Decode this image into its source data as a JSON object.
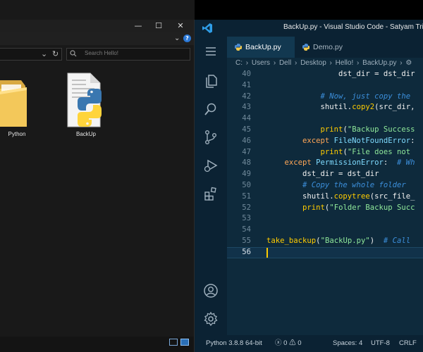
{
  "explorer": {
    "window_controls": {
      "minimize": "—",
      "maximize": "☐",
      "close": "✕"
    },
    "search_placeholder": "Search Hello!",
    "files": [
      {
        "name": "Python",
        "type": "folder"
      },
      {
        "name": "BackUp",
        "type": "python-file"
      }
    ]
  },
  "vscode": {
    "title": "BackUp.py - Visual Studio Code - Satyam Trip",
    "tabs": [
      {
        "label": "BackUp.py",
        "active": true
      },
      {
        "label": "Demo.py",
        "active": false
      }
    ],
    "breadcrumb": [
      "C:",
      "Users",
      "Dell",
      "Desktop",
      "Hello!",
      "BackUp.py",
      "⚙"
    ],
    "lines": [
      {
        "n": "40",
        "tokens": [
          [
            "var",
            "                dst_dir = dst_dir"
          ]
        ]
      },
      {
        "n": "41",
        "tokens": []
      },
      {
        "n": "42",
        "tokens": [
          [
            "cm",
            "            # Now, just copy the"
          ]
        ]
      },
      {
        "n": "43",
        "tokens": [
          [
            "var",
            "            shutil."
          ],
          [
            "fn",
            "copy2"
          ],
          [
            "var",
            "(src_dir,"
          ]
        ]
      },
      {
        "n": "44",
        "tokens": []
      },
      {
        "n": "45",
        "tokens": [
          [
            "fn",
            "            print"
          ],
          [
            "var",
            "("
          ],
          [
            "str",
            "\"Backup Success"
          ]
        ]
      },
      {
        "n": "46",
        "tokens": [
          [
            "kw",
            "        except "
          ],
          [
            "cls",
            "FileNotFoundError"
          ],
          [
            "var",
            ":"
          ]
        ]
      },
      {
        "n": "47",
        "tokens": [
          [
            "fn",
            "            print"
          ],
          [
            "var",
            "("
          ],
          [
            "str",
            "\"File does not"
          ]
        ]
      },
      {
        "n": "48",
        "tokens": [
          [
            "kw",
            "    except "
          ],
          [
            "cls",
            "PermissionError"
          ],
          [
            "var",
            ":  "
          ],
          [
            "cm",
            "# Wh"
          ]
        ]
      },
      {
        "n": "49",
        "tokens": [
          [
            "var",
            "        dst_dir = dst_dir"
          ]
        ]
      },
      {
        "n": "50",
        "tokens": [
          [
            "cm",
            "        # Copy the whole folder "
          ]
        ]
      },
      {
        "n": "51",
        "tokens": [
          [
            "var",
            "        shutil."
          ],
          [
            "fn",
            "copytree"
          ],
          [
            "var",
            "(src_file_"
          ]
        ]
      },
      {
        "n": "52",
        "tokens": [
          [
            "fn",
            "        print"
          ],
          [
            "var",
            "("
          ],
          [
            "str",
            "\"Folder Backup Succ"
          ]
        ]
      },
      {
        "n": "53",
        "tokens": []
      },
      {
        "n": "54",
        "tokens": []
      },
      {
        "n": "55",
        "tokens": [
          [
            "fn",
            "take_backup"
          ],
          [
            "var",
            "("
          ],
          [
            "str",
            "\"BackUp.py\""
          ],
          [
            "var",
            ")  "
          ],
          [
            "cm",
            "# Call"
          ]
        ]
      },
      {
        "n": "56",
        "tokens": []
      }
    ],
    "current_line": "56",
    "status": {
      "interpreter": "Python 3.8.8 64-bit",
      "errors": "0",
      "warnings": "0",
      "spaces": "Spaces: 4",
      "encoding": "UTF-8",
      "eol": "CRLF"
    }
  }
}
